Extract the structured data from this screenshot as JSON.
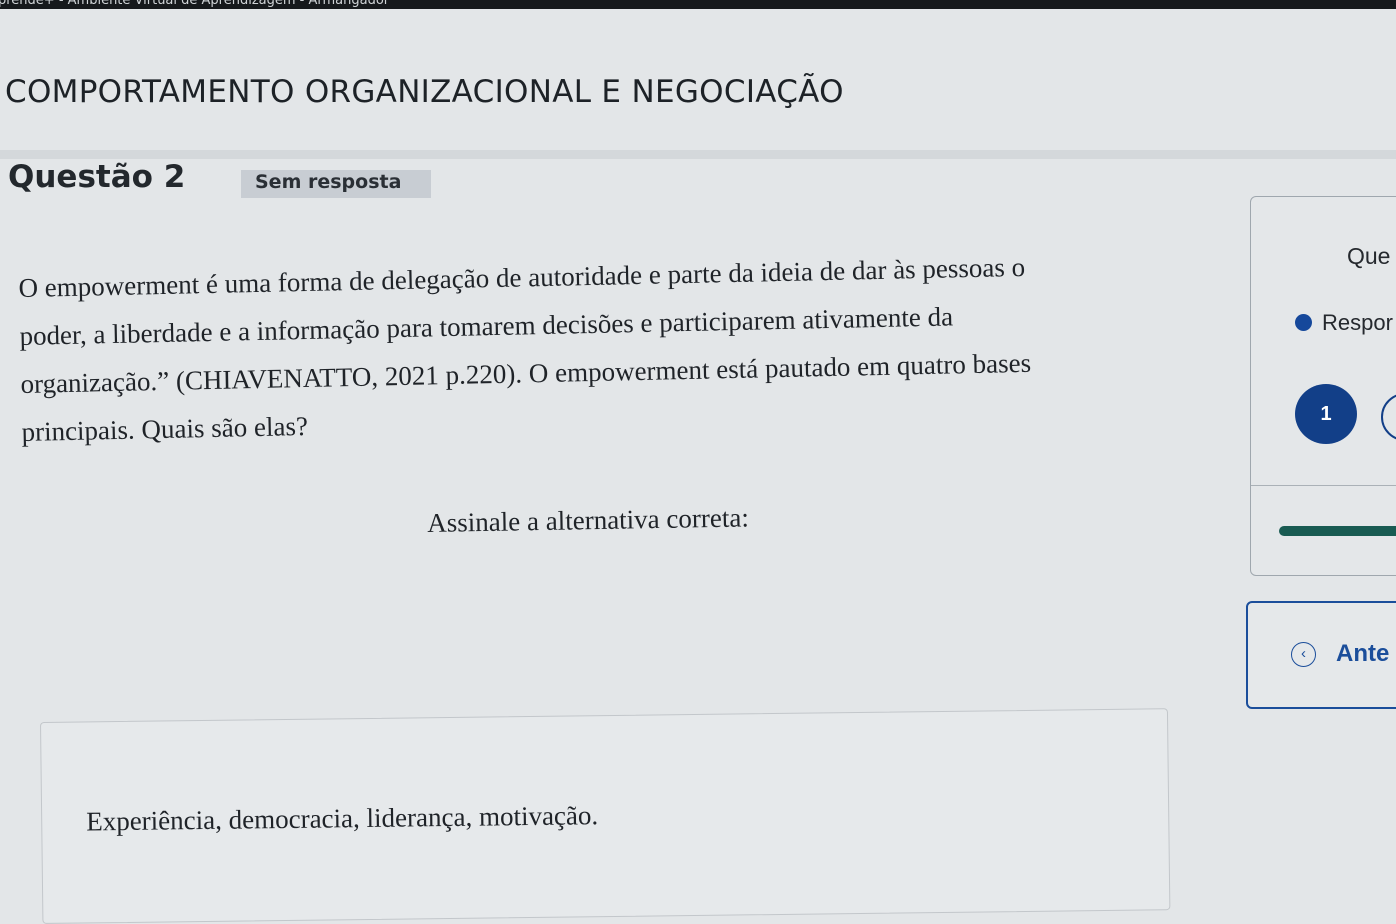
{
  "window": {
    "title_fragment": "prende+ - Ambiente Virtual de Aprendizagem - Armangador"
  },
  "course": {
    "title": "COMPORTAMENTO ORGANIZACIONAL E NEGOCIAÇÃO"
  },
  "question": {
    "header": "Questão 2",
    "status": "Sem resposta",
    "text_lines": [
      "O empowerment é uma forma de delegação de autoridade e parte da ideia de dar às pessoas o",
      "poder, a liberdade e a informação para tomarem decisões e participarem ativamente da",
      "organização.” (CHIAVENATTO, 2021 p.220). O empowerment está pautado em quatro bases",
      "principais. Quais são elas?"
    ],
    "instruction": "Assinale a alternativa correta:",
    "option_text": "Experiência, democracia, liderança, motivação."
  },
  "sidebar": {
    "title": "Que",
    "legend_label": "Respor",
    "legend_color": "#15489b",
    "current_question_number": "1",
    "progress_fraction": 1.0,
    "progress_color": "#195b52"
  },
  "nav": {
    "previous_icon": "chevron-left-circle-icon",
    "previous_label": "Ante",
    "accent_color": "#1b4e9b"
  }
}
